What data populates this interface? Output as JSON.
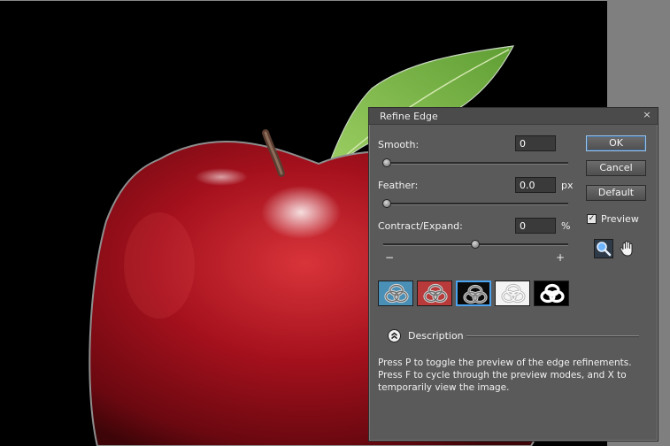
{
  "dialog": {
    "title": "Refine Edge",
    "close_glyph": "×",
    "smooth": {
      "label": "Smooth:",
      "value": "0",
      "slider_fraction": 0.0
    },
    "feather": {
      "label": "Feather:",
      "value": "0.0",
      "unit": "px",
      "slider_fraction": 0.0
    },
    "contract_expand": {
      "label": "Contract/Expand:",
      "value": "0",
      "unit": "%",
      "minus": "−",
      "plus": "+",
      "slider_fraction": 0.5
    },
    "buttons": {
      "ok": "OK",
      "cancel": "Cancel",
      "default": "Default"
    },
    "preview": {
      "label": "Preview",
      "checked": true,
      "check_glyph": "✓"
    },
    "tools": {
      "zoom": "zoom-icon",
      "hand": "hand-icon"
    },
    "preview_modes": [
      {
        "name": "custom-overlay",
        "bg": "#4a8fb5",
        "selected": false
      },
      {
        "name": "quick-mask",
        "bg": "#b83a3a",
        "selected": false
      },
      {
        "name": "on-black",
        "bg": "#0a0a0a",
        "selected": true
      },
      {
        "name": "on-white",
        "bg": "#f4f4f4",
        "selected": false
      },
      {
        "name": "mask",
        "bg": "#000000",
        "selected": false
      }
    ],
    "description": {
      "label": "Description",
      "text": "Press P to toggle the preview of the edge refinements. Press F to cycle through the preview modes, and X to temporarily view the image."
    }
  },
  "colors": {
    "accent": "#4aa3f0",
    "dialog_bg": "#5a5a5a",
    "canvas_bg": "#000000",
    "gutter": "#7f7f7f"
  }
}
